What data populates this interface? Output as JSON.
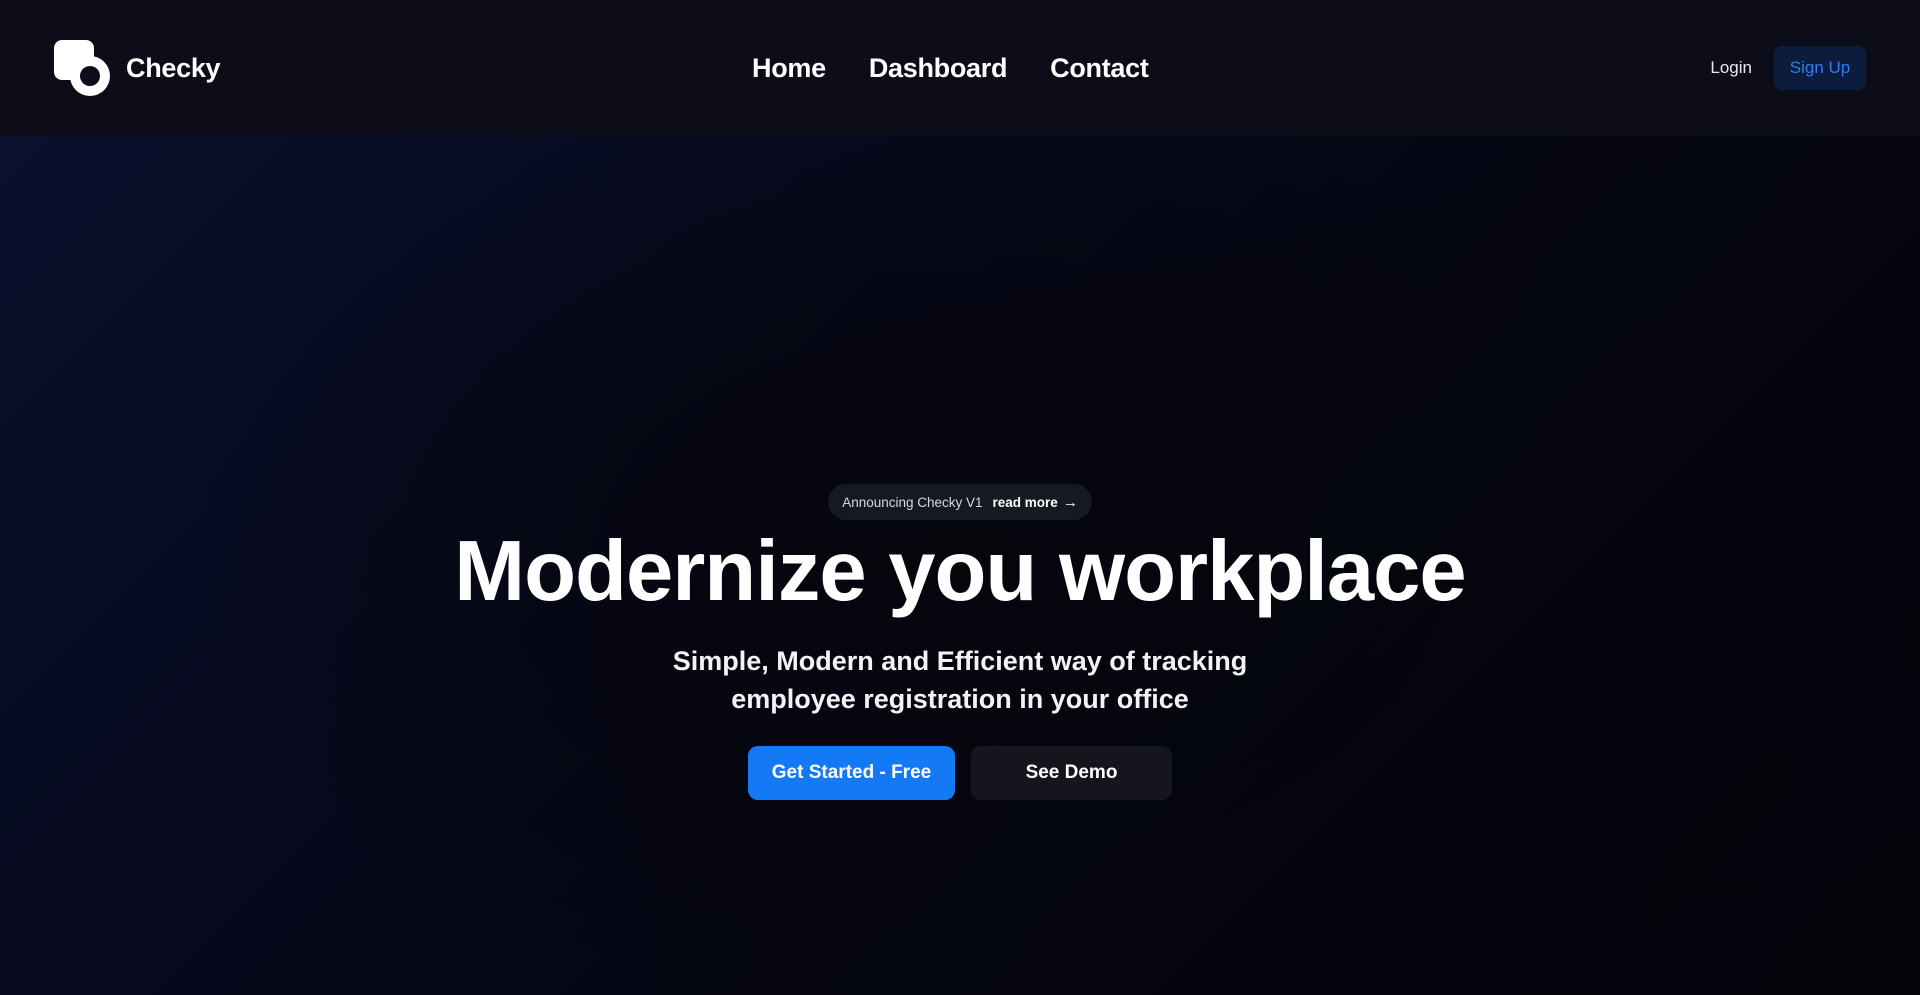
{
  "header": {
    "brand": {
      "name": "Checky",
      "logo_icon": "checky-logo-icon"
    },
    "nav": [
      {
        "label": "Home"
      },
      {
        "label": "Dashboard"
      },
      {
        "label": "Contact"
      }
    ],
    "login_label": "Login",
    "signup_label": "Sign Up"
  },
  "hero": {
    "announcement": {
      "text": "Announcing Checky V1",
      "link_label": "read more",
      "arrow_icon": "arrow-right-icon"
    },
    "headline": "Modernize you workplace",
    "subheadline_line1": "Simple, Modern and Efficient way of tracking",
    "subheadline_line2": "employee registration in your office",
    "primary_cta": "Get Started - Free",
    "secondary_cta": "See Demo"
  },
  "colors": {
    "background": "#05060f",
    "header_background": "#0c0d18",
    "accent": "#1479f5",
    "signup_text": "#2f7df6",
    "signup_background": "#0c1c3c"
  }
}
